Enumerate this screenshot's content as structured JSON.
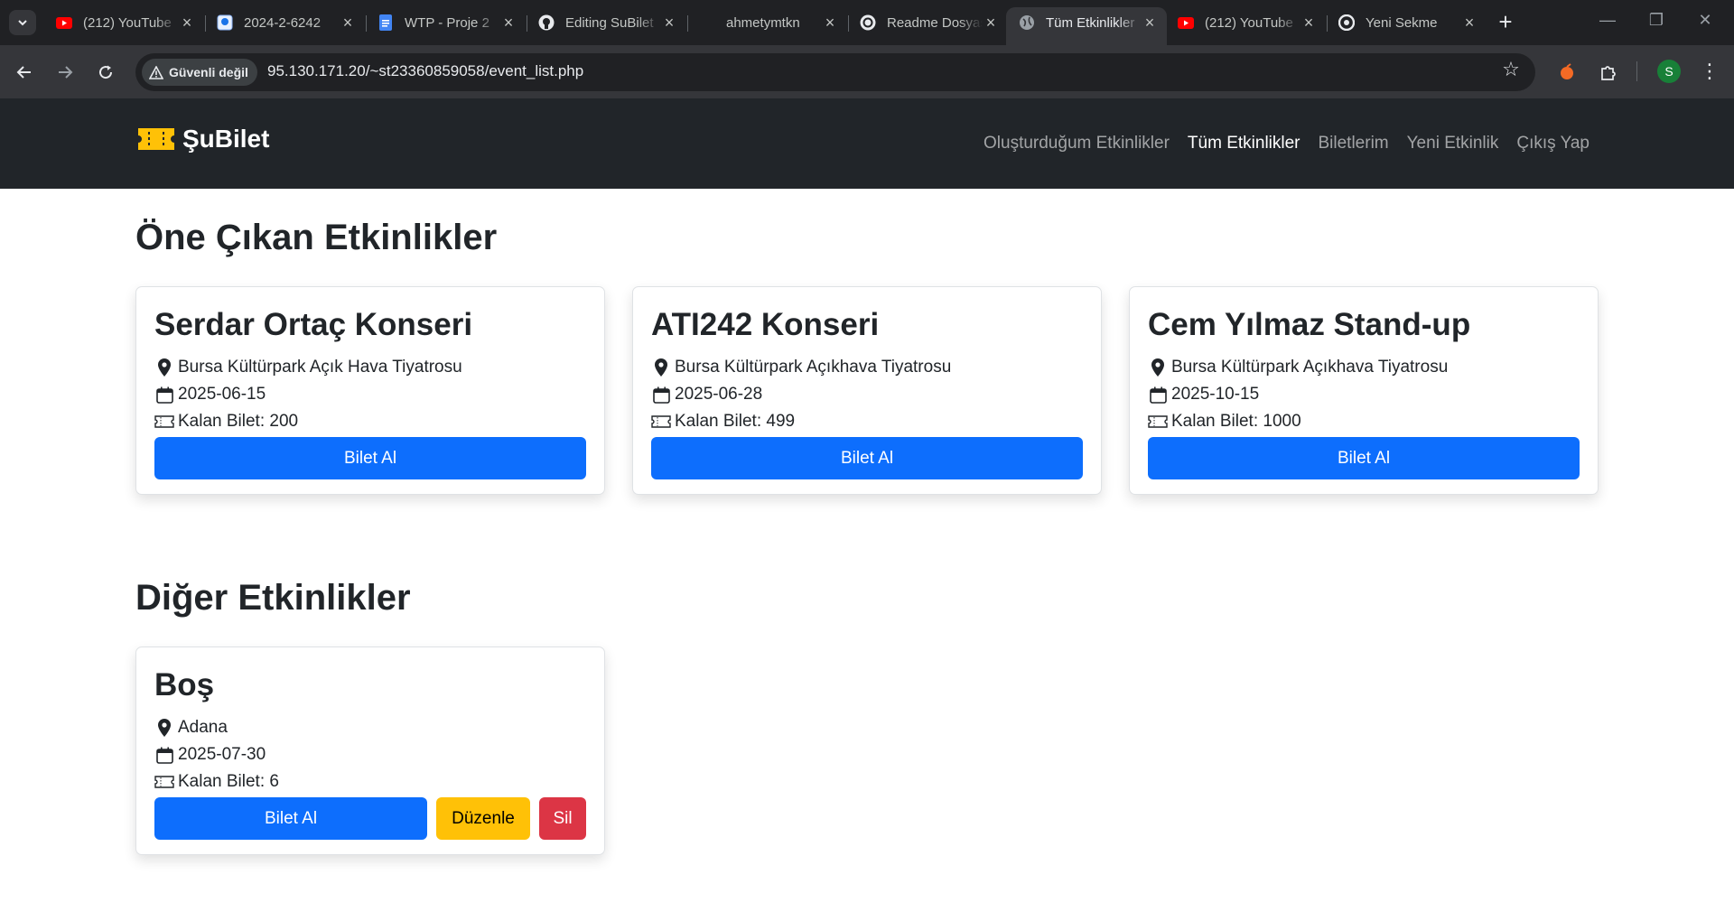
{
  "browser": {
    "tabs": [
      {
        "title": "(212) YouTube",
        "favicon": "youtube-icon",
        "active": false
      },
      {
        "title": "2024-2-6242",
        "favicon": "document-icon",
        "active": false
      },
      {
        "title": "WTP - Proje 2",
        "favicon": "google-docs-icon",
        "active": false
      },
      {
        "title": "Editing SuBilet",
        "favicon": "github-icon",
        "active": false
      },
      {
        "title": "ahmetymtkn",
        "favicon": "blank-icon",
        "active": false
      },
      {
        "title": "Readme Dosyası",
        "favicon": "chatgpt-icon",
        "active": false
      },
      {
        "title": "Tüm Etkinlikler",
        "favicon": "globe-icon",
        "active": true
      },
      {
        "title": "(212) YouTube",
        "favicon": "youtube-icon",
        "active": false
      },
      {
        "title": "Yeni Sekme",
        "favicon": "chrome-icon",
        "active": false
      }
    ],
    "security_label": "Güvenli değil",
    "url": "95.130.171.20/~st23360859058/event_list.php",
    "profile_initial": "S"
  },
  "site": {
    "brand": "ŞuBilet",
    "nav": {
      "created": "Oluşturduğum Etkinlikler",
      "all": "Tüm Etkinlikler",
      "tickets": "Biletlerim",
      "new": "Yeni Etkinlik",
      "logout": "Çıkış Yap"
    }
  },
  "featured": {
    "title": "Öne Çıkan Etkinlikler",
    "events": [
      {
        "name": "Serdar Ortaç Konseri",
        "location": "Bursa Kültürpark Açık Hava Tiyatrosu",
        "date": "2025-06-15",
        "remaining": "Kalan Bilet: 200",
        "buy_label": "Bilet Al"
      },
      {
        "name": "ATI242 Konseri",
        "location": "Bursa Kültürpark Açıkhava Tiyatrosu",
        "date": "2025-06-28",
        "remaining": "Kalan Bilet: 499",
        "buy_label": "Bilet Al"
      },
      {
        "name": "Cem Yılmaz Stand-up",
        "location": "Bursa Kültürpark Açıkhava Tiyatrosu",
        "date": "2025-10-15",
        "remaining": "Kalan Bilet: 1000",
        "buy_label": "Bilet Al"
      }
    ]
  },
  "other": {
    "title": "Diğer Etkinlikler",
    "events": [
      {
        "name": "Boş",
        "location": "Adana",
        "date": "2025-07-30",
        "remaining": "Kalan Bilet: 6",
        "buy_label": "Bilet Al",
        "edit_label": "Düzenle",
        "delete_label": "Sil"
      }
    ]
  },
  "colors": {
    "primary": "#0d6efd",
    "warning": "#ffc107",
    "danger": "#dc3545",
    "navbar": "#212529",
    "brand_logo": "#ffc107"
  }
}
